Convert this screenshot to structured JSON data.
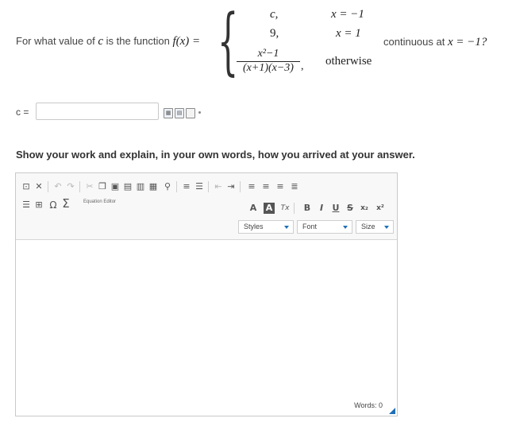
{
  "question": {
    "prefix": "For what value of",
    "var_c": "c",
    "middle": "is the function",
    "func": "f(x) =",
    "cases": [
      {
        "value": "c,",
        "condition": "x = −1"
      },
      {
        "value": "9,",
        "condition": "x = 1"
      },
      {
        "value_numerator": "x²−1",
        "value_denominator": "(x+1)(x−3)",
        "value_suffix": ",",
        "condition": "otherwise"
      }
    ],
    "suffix_text": "continuous at",
    "suffix_math": "x = −1?"
  },
  "answer": {
    "label": "c =",
    "value": "",
    "placeholder": ""
  },
  "answer_tools": [
    "preview-icon",
    "insert-icon",
    "document-icon",
    "dot-icon"
  ],
  "instructions": "Show your work and explain, in your own words, how you arrived at your answer.",
  "editor": {
    "toolbar_row1": [
      "source-icon",
      "maximize-icon",
      "undo-icon",
      "redo-icon",
      "cut-icon",
      "copy-icon",
      "paste-icon",
      "paste-text-icon",
      "paste-word-icon",
      "find-icon",
      "numbered-list-icon",
      "bullet-list-icon",
      "outdent-icon",
      "indent-icon",
      "align-left-icon",
      "align-center-icon",
      "align-right-icon",
      "justify-icon"
    ],
    "equation_editor_label": "Equation Editor",
    "format_buttons": {
      "text_color": "A",
      "bg_color": "A",
      "remove_format": "Tx",
      "bold": "B",
      "italic": "I",
      "underline": "U",
      "strike": "S",
      "subscript": "x₂",
      "superscript": "x²"
    },
    "styles_label": "Styles",
    "font_label": "Font",
    "size_label": "Size",
    "content": "",
    "word_count_text": "Words: 0"
  },
  "colors": {
    "accent": "#1d6fb8",
    "border": "#c9c9c9",
    "toolbar_bg": "#f8f8f8"
  }
}
